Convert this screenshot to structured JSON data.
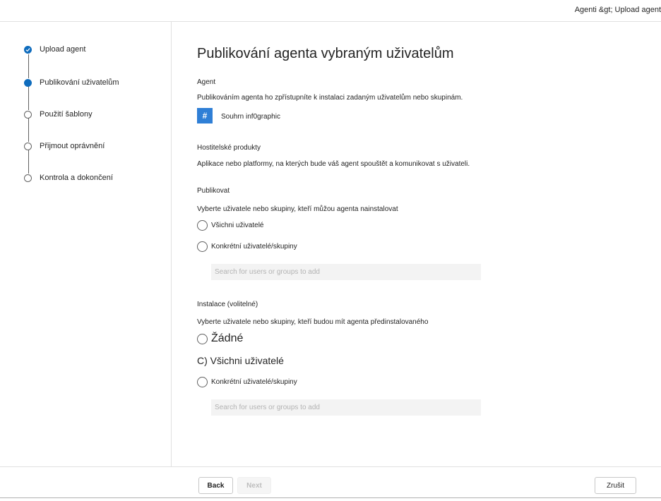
{
  "header": {
    "breadcrumb": "Agenti &gt; Upload agent"
  },
  "steps": [
    {
      "label": "Upload agent",
      "state": "done"
    },
    {
      "label": "Publikování uživatelům",
      "state": "current"
    },
    {
      "label": "Použití šablony",
      "state": "pending"
    },
    {
      "label": "Přijmout oprávnění",
      "state": "pending"
    },
    {
      "label": "Kontrola a dokončení",
      "state": "pending"
    }
  ],
  "main": {
    "title": "Publikování agenta vybraným uživatelům",
    "agent_section": {
      "label": "Agent",
      "description": "Publikováním agenta ho zpřístupníte k instalaci zadaným uživatelům nebo skupinám.",
      "tile_icon": "#",
      "agent_name": "Souhrn inf0graphic"
    },
    "host_section": {
      "label": "Hostitelské produkty",
      "description": "Aplikace nebo platformy, na kterých bude váš agent spouštět a komunikovat s uživateli."
    },
    "publish_section": {
      "label": "Publikovat",
      "description": "Vyberte uživatele nebo skupiny, kteří můžou agenta nainstalovat",
      "options": [
        "Všichni uživatelé",
        "Konkrétní uživatelé/skupiny"
      ],
      "search_placeholder": "Search for users or groups to add"
    },
    "install_section": {
      "label": "Instalace (volitelné)",
      "description": "Vyberte uživatele nebo skupiny, kteří budou mít agenta předinstalovaného",
      "option_none": "Žádné",
      "option_all": "C) Všichni uživatelé",
      "option_specific": "Konkrétní uživatelé/skupiny",
      "search_placeholder": "Search for users or groups to add"
    }
  },
  "footer": {
    "back_label": "Back",
    "next_label": "Next",
    "cancel_label": "Zrušit"
  },
  "colors": {
    "accent": "#0f6cbd",
    "tile": "#2f7fd6"
  }
}
